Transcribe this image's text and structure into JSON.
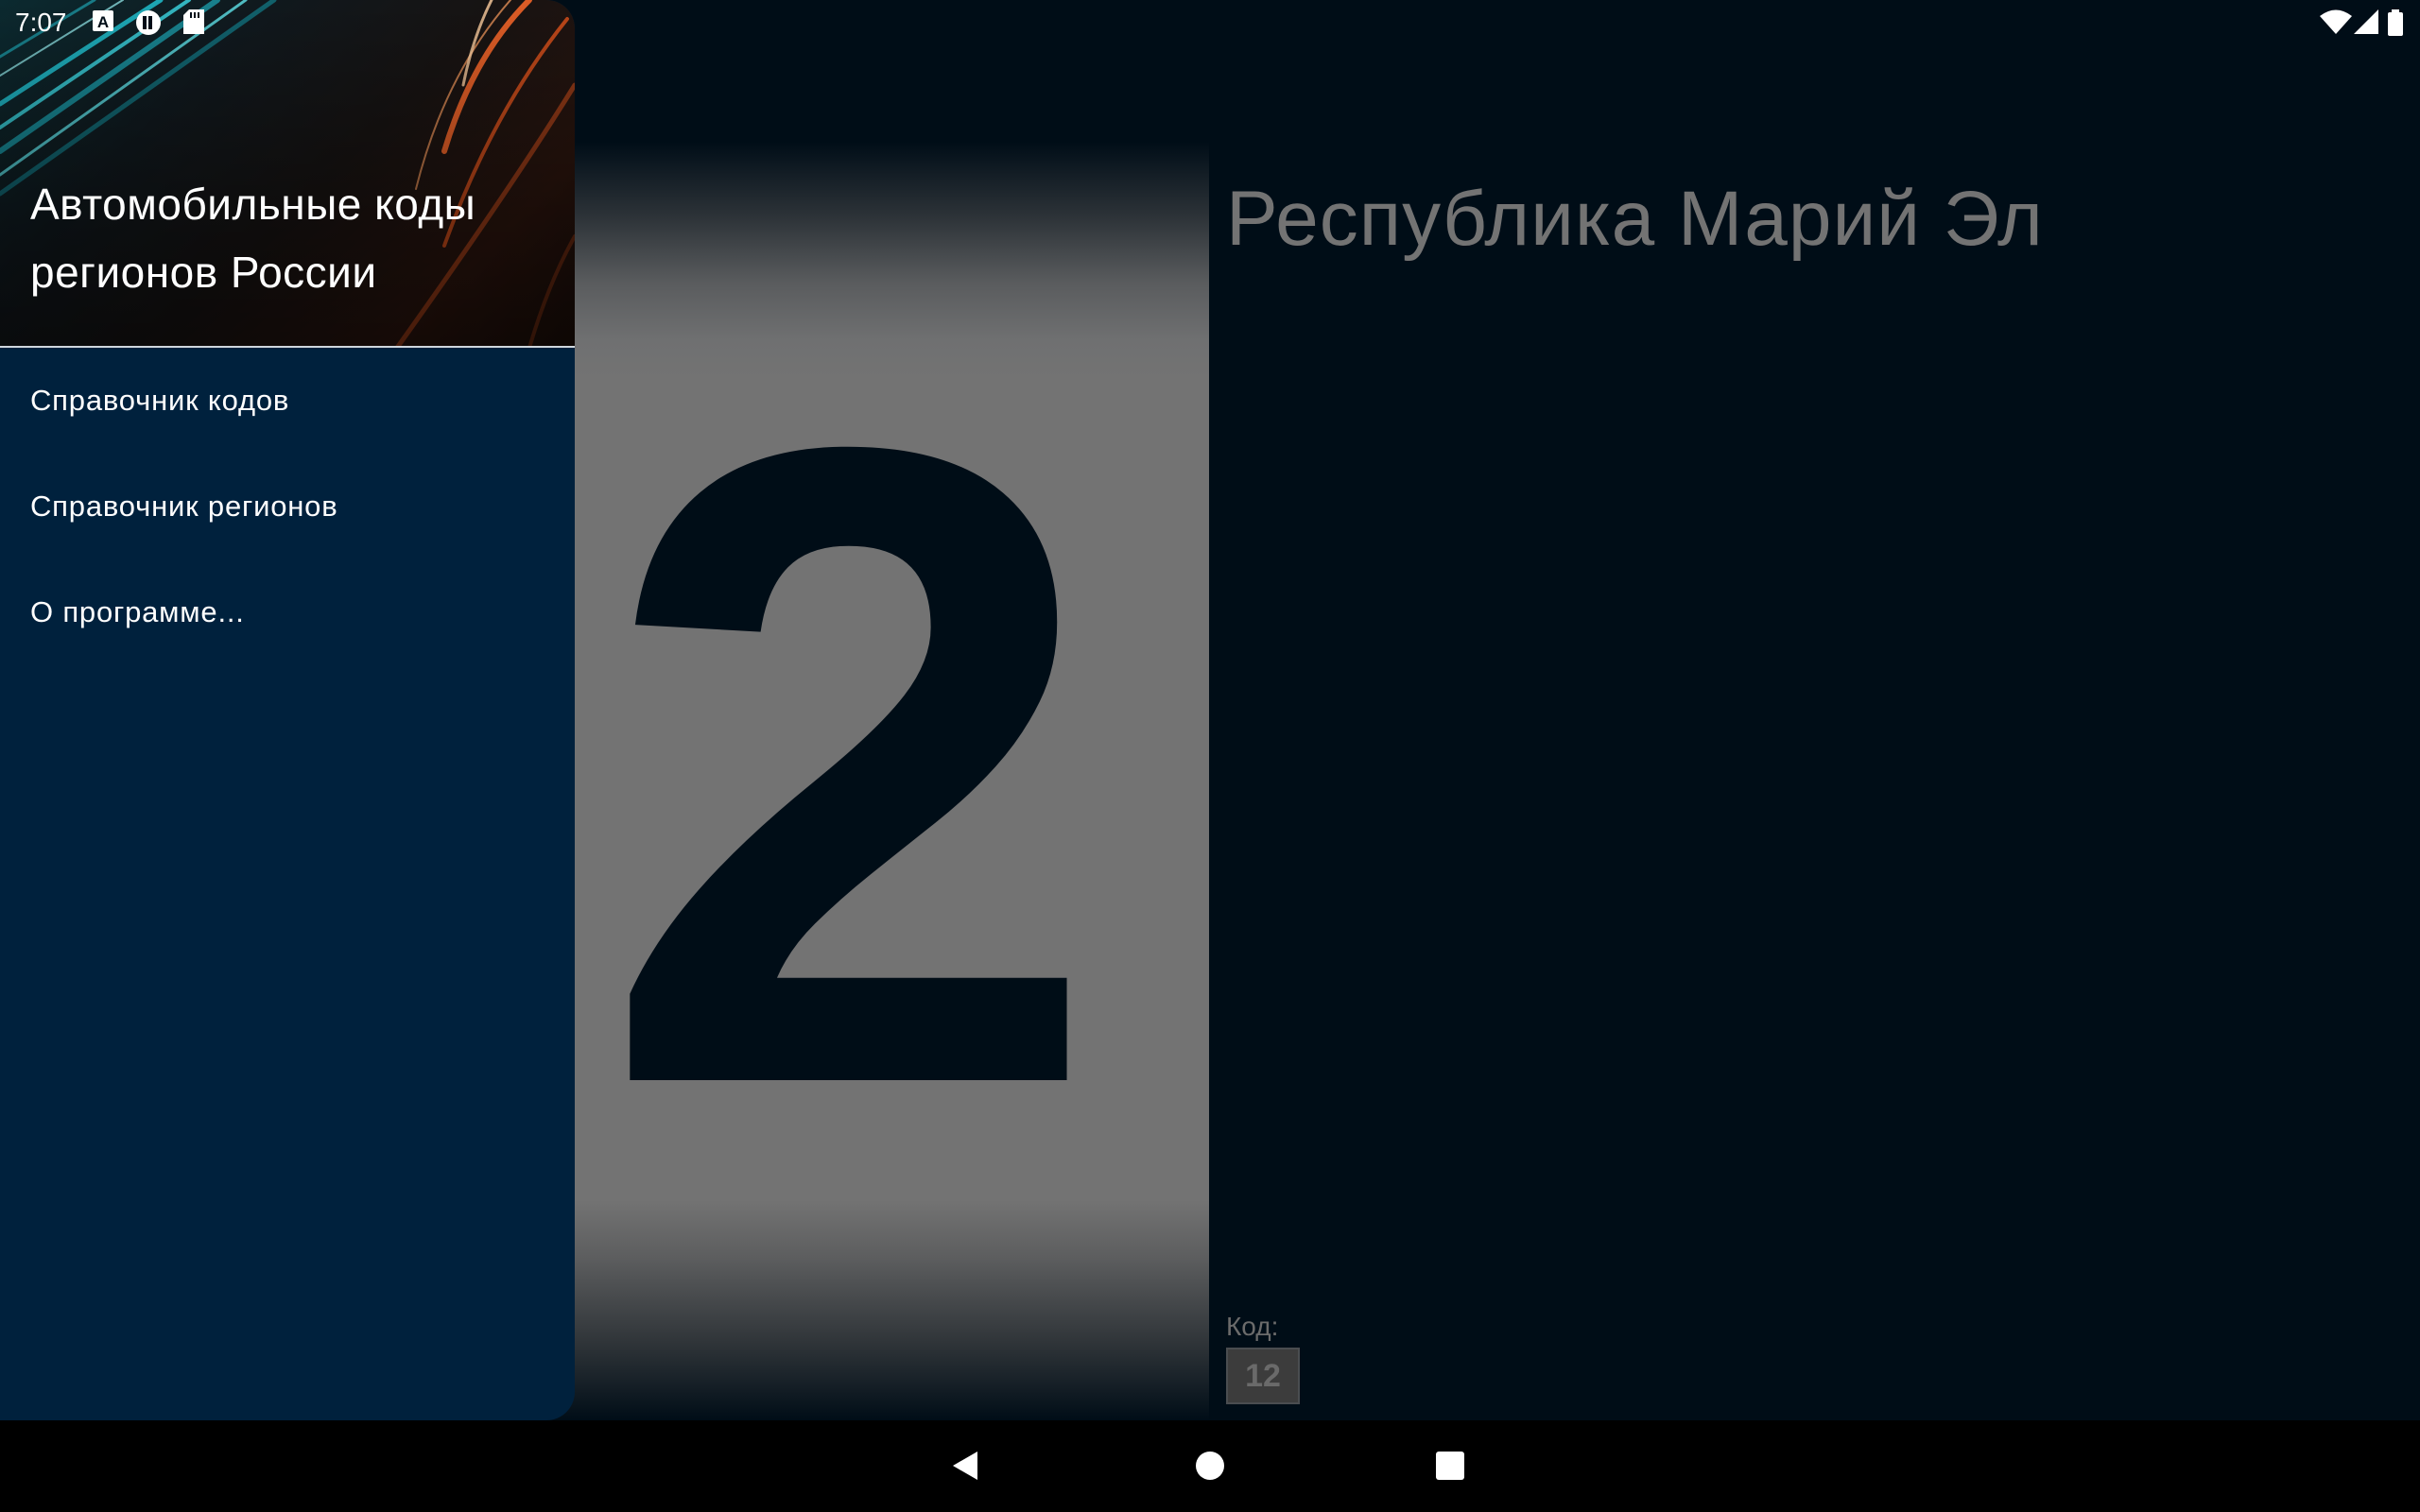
{
  "status_bar": {
    "time": "7:07",
    "left_icons": [
      "font-a-icon",
      "lastpass-icon",
      "sd-card-icon"
    ],
    "right_icons": [
      "wifi-icon",
      "cell-signal-icon",
      "battery-icon"
    ]
  },
  "drawer": {
    "title": "Автомобильные коды регионов России",
    "items": [
      {
        "label": "Справочник кодов"
      },
      {
        "label": "Справочник регионов"
      },
      {
        "label": "О программе..."
      }
    ]
  },
  "main": {
    "plate_digit": "2",
    "region_name": "Республика Марий Эл",
    "code_label": "Код:",
    "code_value": "12"
  },
  "nav_bar": {
    "buttons": [
      "back-icon",
      "home-icon",
      "recents-icon"
    ]
  },
  "colors": {
    "drawer_bg": "#00213d",
    "app_bg": "#000d17",
    "plate_gray": "#737373",
    "muted_text": "#737373"
  }
}
